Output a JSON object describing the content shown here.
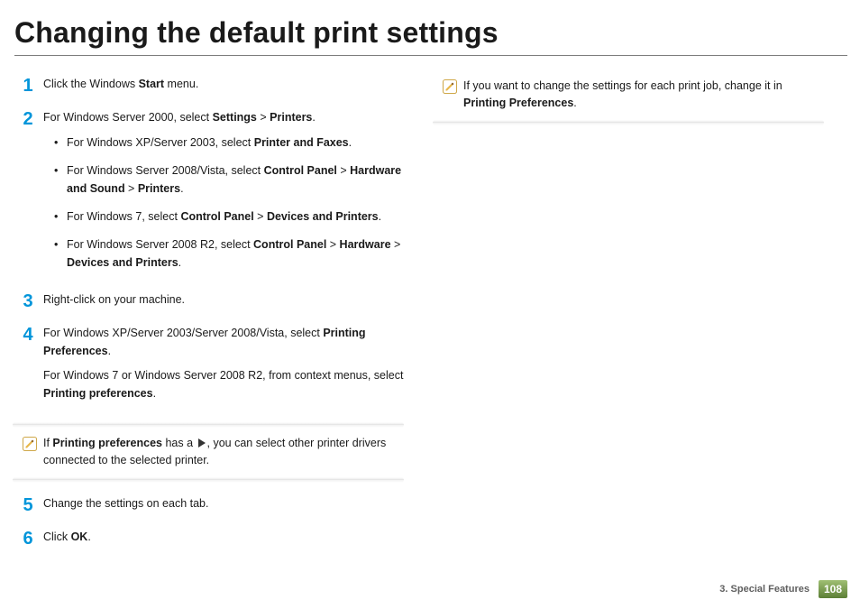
{
  "title": "Changing the default print settings",
  "steps": {
    "s1": {
      "num": "1",
      "a1": "Click the Windows ",
      "a2": "Start",
      "a3": " menu."
    },
    "s2": {
      "num": "2",
      "lead1": "For Windows Server 2000, select ",
      "lead2": "Settings",
      "lead3": " > ",
      "lead4": "Printers",
      "lead5": ".",
      "b1a": "For Windows XP/Server 2003, select ",
      "b1b": "Printer and Faxes",
      "b1c": ".",
      "b2a": "For Windows Server 2008/Vista, select ",
      "b2b": "Control Panel",
      "b2c": " > ",
      "b2d": "Hardware and Sound",
      "b2e": " > ",
      "b2f": "Printers",
      "b2g": ".",
      "b3a": "For Windows 7, select ",
      "b3b": "Control Panel",
      "b3c": " > ",
      "b3d": "Devices and Printers",
      "b3e": ".",
      "b4a": "For Windows Server 2008 R2, select ",
      "b4b": "Control Panel",
      "b4c": " > ",
      "b4d": "Hardware",
      "b4e": " > ",
      "b4f": "Devices and Printers",
      "b4g": "."
    },
    "s3": {
      "num": "3",
      "a": "Right-click on your machine."
    },
    "s4": {
      "num": "4",
      "p1a": "For Windows XP/Server 2003/Server 2008/Vista, select ",
      "p1b": "Printing Preferences",
      "p1c": ".",
      "p2a": "For Windows 7 or Windows Server 2008 R2, from context menus, select ",
      "p2b": "Printing preferences",
      "p2c": "."
    },
    "s5": {
      "num": "5",
      "a": "Change the settings on each tab."
    },
    "s6": {
      "num": "6",
      "a1": "Click ",
      "a2": "OK",
      "a3": "."
    }
  },
  "note1": {
    "a": "If ",
    "b": "Printing preferences",
    "c": " has a ",
    "d": ", you can select other printer drivers connected to the selected printer."
  },
  "note2": {
    "a": "If you want to change the settings for each print job, change it in ",
    "b": "Printing Preferences",
    "c": "."
  },
  "footer": {
    "chapter": "3.  Special Features",
    "page": "108"
  }
}
